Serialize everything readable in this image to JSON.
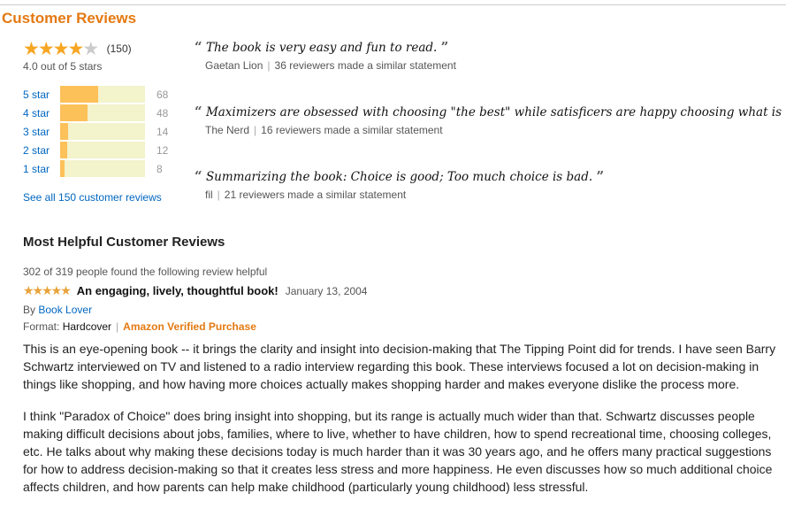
{
  "header": {
    "title": "Customer Reviews"
  },
  "summary": {
    "rating": 4.0,
    "max": 5,
    "count": "(150)",
    "avg_text": "4.0 out of 5 stars",
    "see_all": "See all 150 customer reviews",
    "histogram": [
      {
        "label": "5 star",
        "count": "68",
        "percent": 45
      },
      {
        "label": "4 star",
        "count": "48",
        "percent": 32
      },
      {
        "label": "3 star",
        "count": "14",
        "percent": 9
      },
      {
        "label": "2 star",
        "count": "12",
        "percent": 8
      },
      {
        "label": "1 star",
        "count": "8",
        "percent": 5
      }
    ]
  },
  "quotes": [
    {
      "text": "The book is very easy and fun to read.",
      "author": "Gaetan Lion",
      "similar": "36 reviewers made a similar statement"
    },
    {
      "text": "Maximizers are obsessed with choosing \"the best\" while satisficers are happy choosing what is \"good enough.\"",
      "author": "The Nerd",
      "similar": "16 reviewers made a similar statement"
    },
    {
      "text": "Summarizing the book: Choice is good; Too much choice is bad.",
      "author": "fil",
      "similar": "21 reviewers made a similar statement"
    }
  ],
  "helpful": {
    "heading": "Most Helpful Customer Reviews",
    "review": {
      "helpful_text": "302 of 319 people found the following review helpful",
      "stars": 5,
      "title": "An engaging, lively, thoughtful book!",
      "date": "January 13, 2004",
      "by_label": "By",
      "author": "Book Lover",
      "format_label": "Format:",
      "format": "Hardcover",
      "verified": "Amazon Verified Purchase",
      "paragraphs": [
        "This is an eye-opening book -- it brings the clarity and insight into decision-making that The Tipping Point did for trends. I have seen Barry Schwartz interviewed on TV and listened to a radio interview regarding this book. These interviews focused a lot on decision-making in things like shopping, and how having more choices actually makes shopping harder and makes everyone dislike the process more.",
        "I think \"Paradox of Choice\" does bring insight into shopping, but its range is actually much wider than that. Schwartz discusses people making difficult decisions about jobs, families, where to live, whether to have children, how to spend recreational time, choosing colleges, etc. He talks about why making these decisions today is much harder than it was 30 years ago, and he offers many practical suggestions for how to address decision-making so that it creates less stress and more happiness. He even discusses how so much additional choice affects children, and how parents can help make childhood (particularly young childhood) less stressful."
      ]
    }
  },
  "colors": {
    "accent": "#e47911",
    "link": "#0066c0",
    "bar_fill": "#fdc15a",
    "bar_bg": "#f3f3cc"
  }
}
